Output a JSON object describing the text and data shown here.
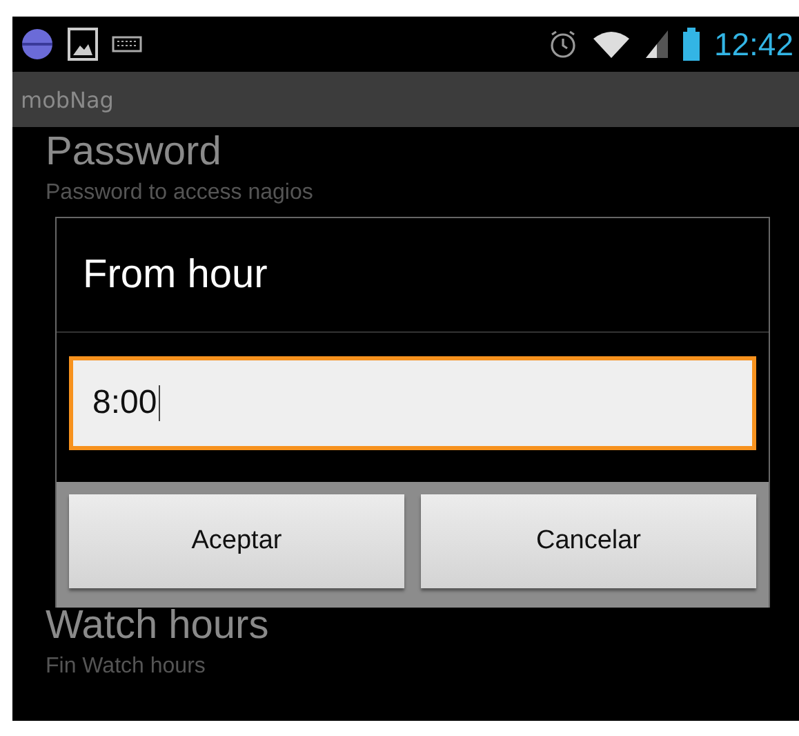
{
  "status_bar": {
    "time": "12:42"
  },
  "app_bar": {
    "title": "mobNag"
  },
  "preferences": [
    {
      "title": "Password",
      "summary": "Password to access nagios"
    },
    {
      "title": "Watch hours",
      "summary": "Fin Watch hours"
    }
  ],
  "dialog": {
    "title": "From hour",
    "field": {
      "value": "8:00",
      "focused": true
    },
    "buttons": [
      "Aceptar",
      "Cancelar"
    ]
  }
}
